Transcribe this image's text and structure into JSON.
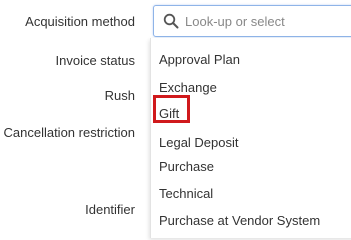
{
  "form": {
    "labels": {
      "acquisition_method": "Acquisition method",
      "invoice_status": "Invoice status",
      "rush": "Rush",
      "cancellation_restriction": "Cancellation restriction",
      "identifier": "Identifier"
    }
  },
  "search": {
    "placeholder": "Look-up or select",
    "value": "",
    "icon": "search-icon"
  },
  "dropdown": {
    "options": [
      "Approval Plan",
      "Exchange",
      "Gift",
      "Legal Deposit",
      "Purchase",
      "Technical",
      "Purchase at Vendor System"
    ],
    "highlighted_option": "Gift",
    "highlight_color": "#d0191c"
  }
}
